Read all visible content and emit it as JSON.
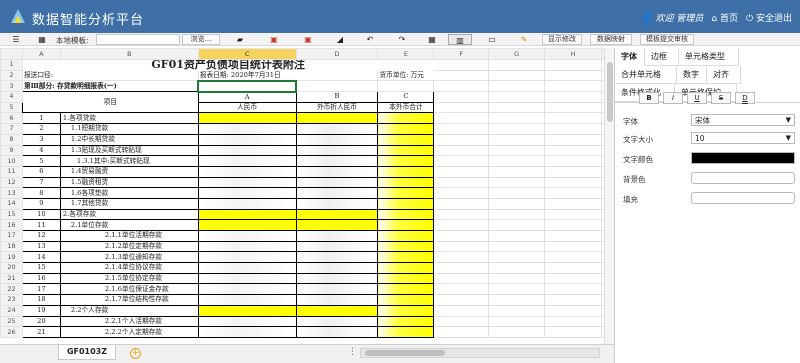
{
  "app": {
    "title": "数据智能分析平台"
  },
  "header": {
    "user": "欢迎 管理员",
    "home": "首页",
    "logout": "安全退出"
  },
  "toolbar": {
    "template_label": "本地模板:",
    "browse": "浏览...",
    "show_changes": "显示修改",
    "data_map": "数据映射",
    "submit_review": "模板提交审核"
  },
  "sheet": {
    "columns": [
      "A",
      "B",
      "C",
      "D",
      "E",
      "F",
      "G",
      "H",
      "I"
    ],
    "title": "GF01资产负债项目统计表附注",
    "org_label": "报送口径:",
    "date_label": "报表日期: 2020年7月31日",
    "unit_label": "货币单位: 万元",
    "section": "第Ⅲ部分: 存贷款明细报表(一)",
    "col_letters": [
      "A",
      "B",
      "C"
    ],
    "item_header": "项目",
    "col_names": [
      "人民币",
      "外币折人民币",
      "本外币合计"
    ],
    "items": [
      {
        "row": "6",
        "no": "1",
        "label": "1.各项贷款",
        "indent": 0
      },
      {
        "row": "7",
        "no": "2",
        "label": "1.1短期贷款",
        "indent": 1
      },
      {
        "row": "8",
        "no": "3",
        "label": "1.2中长期贷款",
        "indent": 1
      },
      {
        "row": "9",
        "no": "4",
        "label": "1.3贴现及买断式转贴现",
        "indent": 1
      },
      {
        "row": "10",
        "no": "5",
        "label": "1.3.1其中:买断式转贴现",
        "indent": 2
      },
      {
        "row": "11",
        "no": "6",
        "label": "1.4贸易融资",
        "indent": 1
      },
      {
        "row": "12",
        "no": "7",
        "label": "1.5融资租赁",
        "indent": 1
      },
      {
        "row": "13",
        "no": "8",
        "label": "1.6各项垫款",
        "indent": 1
      },
      {
        "row": "14",
        "no": "9",
        "label": "1.7其他贷款",
        "indent": 1
      },
      {
        "row": "15",
        "no": "10",
        "label": "2.各项存款",
        "indent": 0
      },
      {
        "row": "16",
        "no": "11",
        "label": "2.1单位存款",
        "indent": 1
      },
      {
        "row": "17",
        "no": "12",
        "label": "2.1.1单位活期存款",
        "indent": 3
      },
      {
        "row": "18",
        "no": "13",
        "label": "2.1.2单位定期存款",
        "indent": 3
      },
      {
        "row": "19",
        "no": "14",
        "label": "2.1.3单位通知存款",
        "indent": 3
      },
      {
        "row": "20",
        "no": "15",
        "label": "2.1.4单位协议存款",
        "indent": 3
      },
      {
        "row": "21",
        "no": "16",
        "label": "2.1.5单位协定存款",
        "indent": 3
      },
      {
        "row": "22",
        "no": "17",
        "label": "2.1.6单位保证金存款",
        "indent": 3
      },
      {
        "row": "23",
        "no": "18",
        "label": "2.1.7单位结构性存款",
        "indent": 3
      },
      {
        "row": "24",
        "no": "19",
        "label": "2.2个人存款",
        "indent": 1
      },
      {
        "row": "25",
        "no": "20",
        "label": "2.2.1个人活期存款",
        "indent": 3
      },
      {
        "row": "26",
        "no": "21",
        "label": "2.2.2个人定期存款",
        "indent": 3
      }
    ],
    "tab_name": "GF0103Z"
  },
  "panel": {
    "tabs_row1": [
      "字体",
      "边框",
      "单元格类型",
      "合并单元格"
    ],
    "tabs_row2": [
      "数字",
      "对齐",
      "条件格式化",
      "单元格保护"
    ],
    "fmt_buttons": [
      "B",
      "I",
      "U",
      "S",
      "D"
    ],
    "font_label": "字体",
    "font_value": "宋体",
    "size_label": "文字大小",
    "size_value": "10",
    "color_label": "文字颜色",
    "bg_label": "背景色",
    "fill_label": "填充"
  },
  "colors": {
    "header_bg": "#3e6fa6",
    "highlight": "#ffff00",
    "selected_col": "#f6d35c"
  }
}
